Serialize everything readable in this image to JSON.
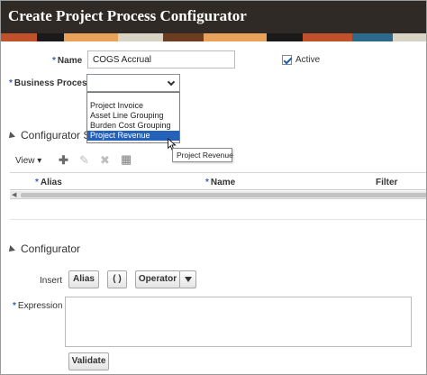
{
  "window": {
    "title": "Create Project Process Configurator"
  },
  "banner_colors": [
    "#c0512a",
    "#e8a25a",
    "#1a1a1a",
    "#d9d3c6",
    "#6e3d1f",
    "#2c6a8c"
  ],
  "form": {
    "name_label": "Name",
    "name_value": "COGS Accrual",
    "active_label": "Active",
    "active_checked": true,
    "business_process_label": "Business Process",
    "business_process_value": "",
    "required_marker": "*"
  },
  "dropdown": {
    "options": [
      "Project Invoice",
      "Asset Line Grouping",
      "Burden Cost Grouping",
      "Project Revenue"
    ],
    "highlighted": "Project Revenue"
  },
  "tooltip": {
    "text": "Project Revenue"
  },
  "configurator_sources": {
    "title": "Configurator S",
    "view_label": "View",
    "toolbar_icons": [
      "add-icon",
      "edit-icon",
      "delete-icon",
      "detach-icon"
    ],
    "columns": [
      "Alias",
      "Name",
      "Filter"
    ]
  },
  "configurator": {
    "title": "Configurator",
    "insert_label": "Insert",
    "alias_button": "Alias",
    "parens_button": "( )",
    "operator_button": "Operator",
    "expression_label": "Expression",
    "expression_value": "",
    "validate_button": "Validate"
  },
  "colors": {
    "accent": "#2461b8",
    "titlebar": "#2f2a26",
    "required": "#2f67b3"
  }
}
